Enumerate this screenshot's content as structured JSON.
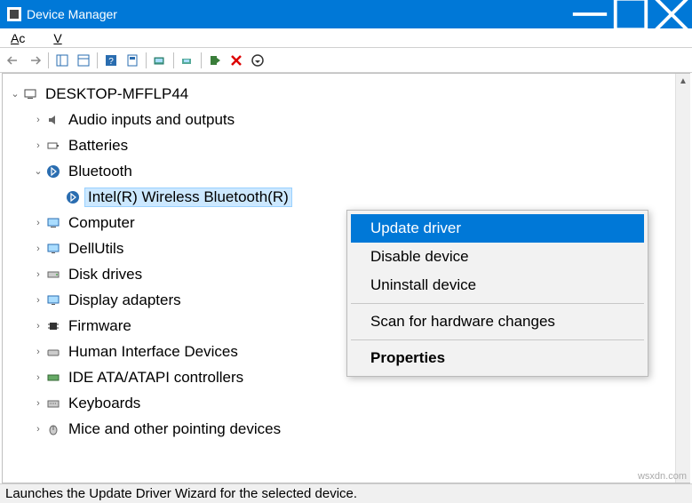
{
  "window": {
    "title": "Device Manager"
  },
  "menubar": {
    "action": "Ac",
    "view": "V"
  },
  "tree": {
    "root_label": "DESKTOP-MFFLP44",
    "nodes": {
      "audio": {
        "label": "Audio inputs and outputs",
        "expanded": false
      },
      "batt": {
        "label": "Batteries",
        "expanded": false
      },
      "bt": {
        "label": "Bluetooth",
        "expanded": true
      },
      "bt_dev": {
        "label": "Intel(R) Wireless Bluetooth(R)"
      },
      "computer": {
        "label": "Computer",
        "expanded": false
      },
      "dell": {
        "label": "DellUtils",
        "expanded": false
      },
      "disk": {
        "label": "Disk drives",
        "expanded": false
      },
      "display": {
        "label": "Display adapters",
        "expanded": false
      },
      "fw": {
        "label": "Firmware",
        "expanded": false
      },
      "hid": {
        "label": "Human Interface Devices",
        "expanded": false
      },
      "ide": {
        "label": "IDE ATA/ATAPI controllers",
        "expanded": false
      },
      "kbd": {
        "label": "Keyboards",
        "expanded": false
      },
      "mouse": {
        "label": "Mice and other pointing devices",
        "expanded": false
      }
    }
  },
  "context_menu": {
    "update": "Update driver",
    "disable": "Disable device",
    "uninstall": "Uninstall device",
    "scan": "Scan for hardware changes",
    "properties": "Properties"
  },
  "status": "Launches the Update Driver Wizard for the selected device.",
  "watermark": "wsxdn.com"
}
